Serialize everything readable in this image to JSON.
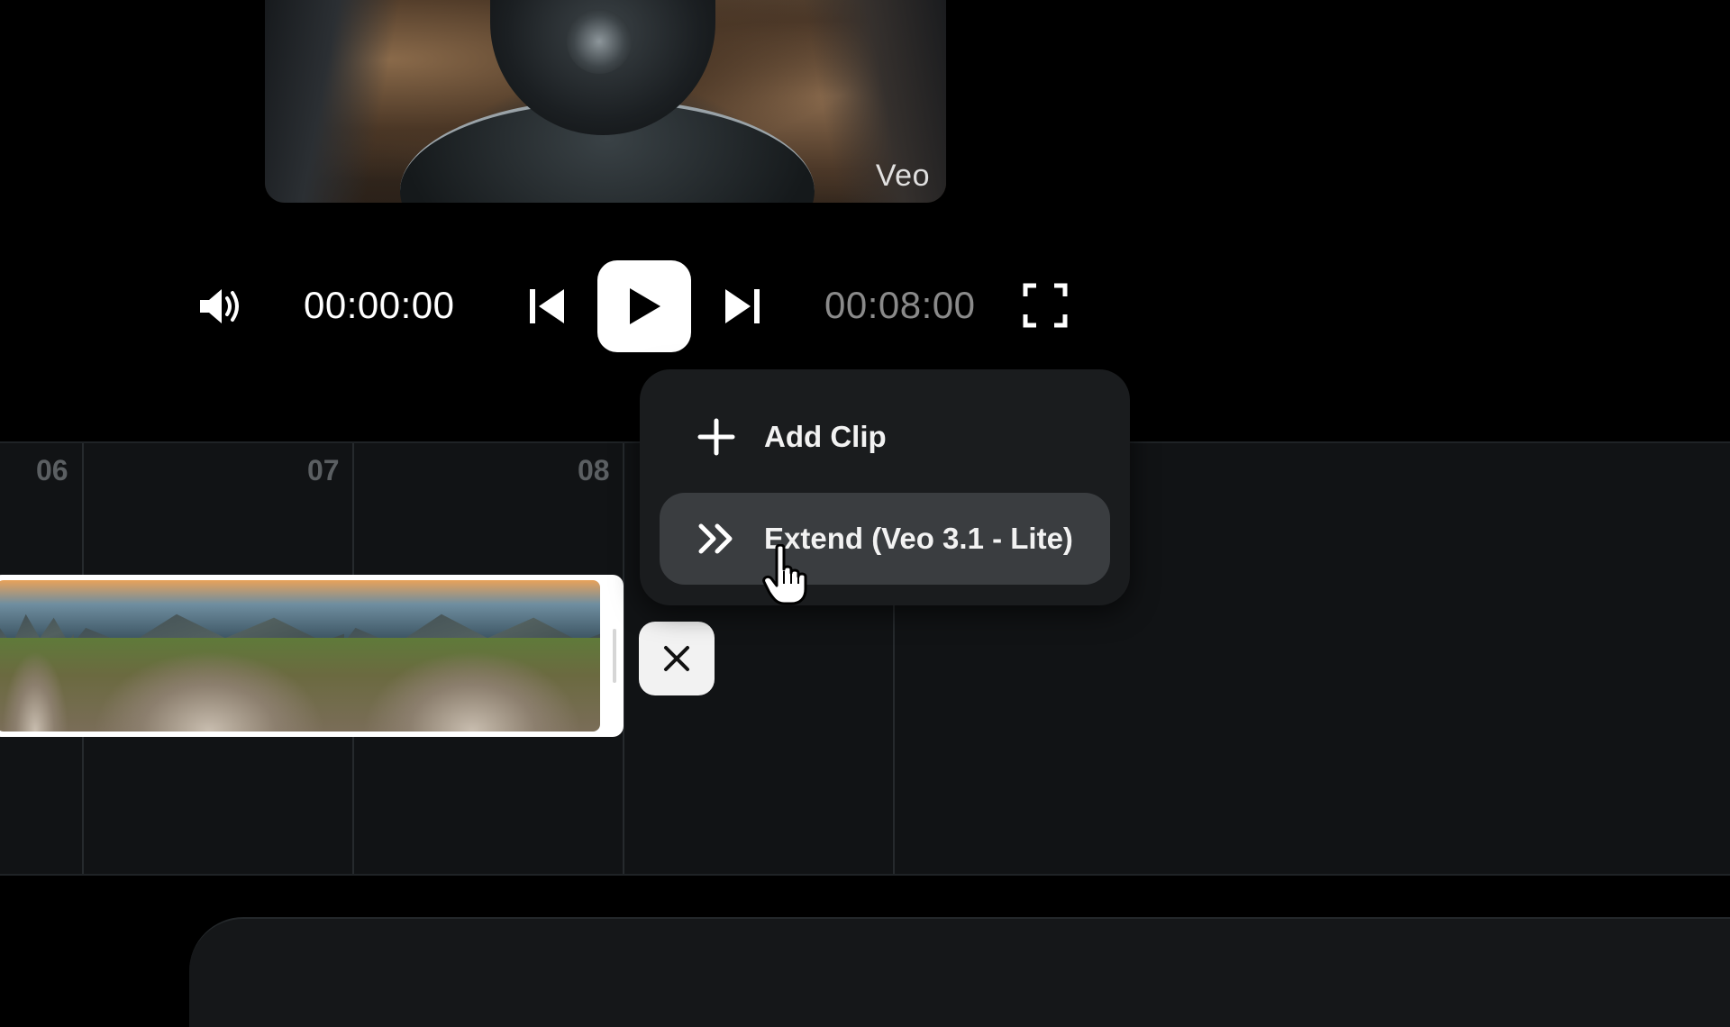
{
  "preview": {
    "watermark": "Veo"
  },
  "player": {
    "current_time": "00:00:00",
    "total_time": "00:08:00",
    "icons": {
      "volume": "speaker-icon",
      "prev": "skip-back-icon",
      "play": "play-icon",
      "next": "skip-forward-icon",
      "fullscreen": "fullscreen-icon"
    }
  },
  "timeline": {
    "ticks": [
      "06",
      "07",
      "08"
    ]
  },
  "context_menu": {
    "items": [
      {
        "label": "Add Clip",
        "icon": "plus-icon"
      },
      {
        "label": "Extend (Veo 3.1 - Lite)",
        "icon": "double-chevron-right-icon"
      }
    ]
  },
  "colors": {
    "background": "#000000",
    "timeline": "#111315",
    "menu": "#1a1c1e",
    "menu_hover": "#3a3d40",
    "total_time": "#8a8a8a"
  }
}
